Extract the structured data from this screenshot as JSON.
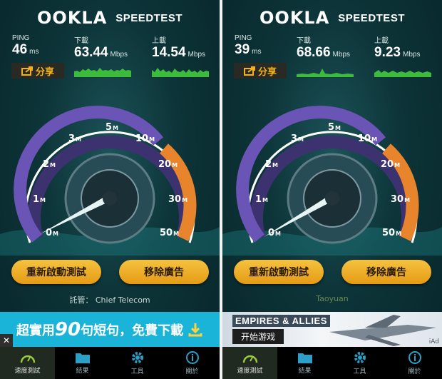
{
  "brand": {
    "logo": "OOKLA",
    "product": "SPEEDTEST"
  },
  "labels": {
    "ping": "PING",
    "download": "下載",
    "upload": "上載",
    "ms": "ms",
    "mbps": "Mbps",
    "share": "分享"
  },
  "gauge": {
    "ticks": [
      "0",
      "1",
      "2",
      "3",
      "5",
      "10",
      "20",
      "30",
      "50"
    ],
    "unit": "M"
  },
  "buttons": {
    "restart": "重新啟動測試",
    "remove_ads": "移除廣告"
  },
  "tabs": [
    "速度測試",
    "結果",
    "工具",
    "關於"
  ],
  "left": {
    "ping": "46",
    "download": "63.44",
    "upload": "14.54",
    "isp": "託管： Chief Telecom",
    "ad": {
      "prefix": "超實用",
      "num": "90",
      "suffix": "句短句，免費下載"
    },
    "close": "✕"
  },
  "right": {
    "ping": "39",
    "download": "68.66",
    "upload": "9.23",
    "isp": "Taoyuan",
    "ad": {
      "title": "EMPIRES & ALLIES",
      "cta": "开始游戏",
      "iad": "iAd"
    }
  },
  "colors": {
    "accent": "#f2b21d",
    "graph": "#3dbb3d",
    "gauge_arc": "#6f54b8",
    "gauge_hot": "#e7812a"
  }
}
